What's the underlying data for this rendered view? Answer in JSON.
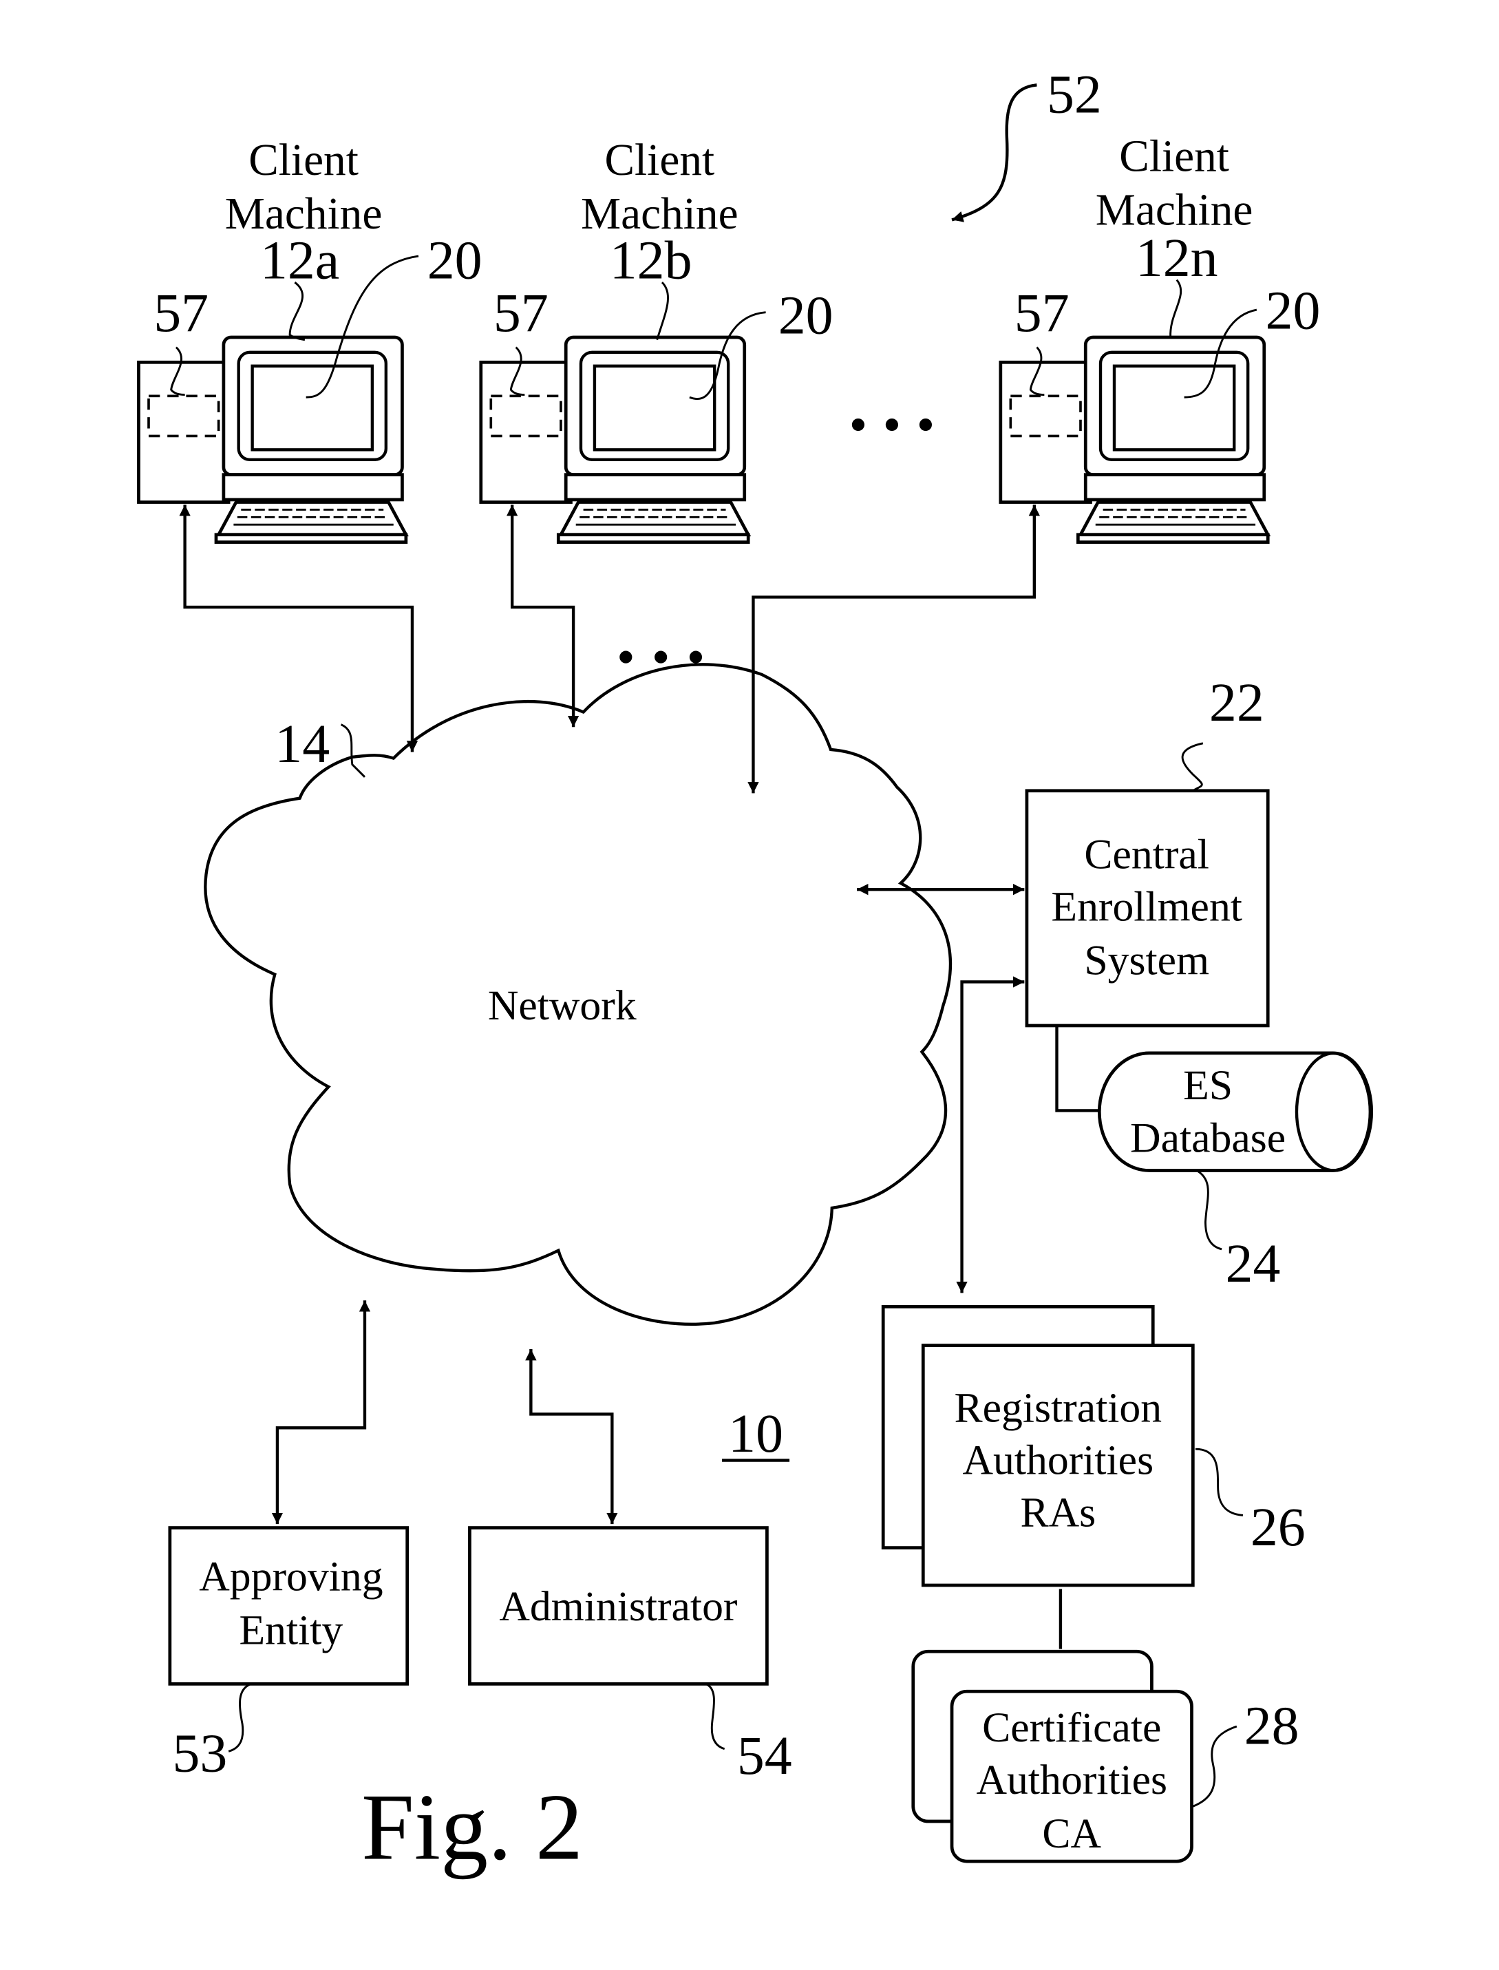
{
  "figure": {
    "title": "Fig. 2",
    "system_ref": "10",
    "group_ref": "52"
  },
  "clients": [
    {
      "line1": "Client",
      "line2": "Machine",
      "ref": "12a",
      "display_ref": "20",
      "storage_ref": "57"
    },
    {
      "line1": "Client",
      "line2": "Machine",
      "ref": "12b",
      "display_ref": "20",
      "storage_ref": "57"
    },
    {
      "line1": "Client",
      "line2": "Machine",
      "ref": "12n",
      "display_ref": "20",
      "storage_ref": "57"
    }
  ],
  "ellipsis": "• • •",
  "network": {
    "label": "Network",
    "ref": "14"
  },
  "central_enrollment": {
    "lines": [
      "Central",
      "Enrollment",
      "System"
    ],
    "ref": "22"
  },
  "es_database": {
    "lines": [
      "ES",
      "Database"
    ],
    "ref": "24"
  },
  "registration_authorities": {
    "lines": [
      "Registration",
      "Authorities",
      "RAs"
    ],
    "ref": "26"
  },
  "certificate_authorities": {
    "lines": [
      "Certificate",
      "Authorities",
      "CA"
    ],
    "ref": "28"
  },
  "approving_entity": {
    "lines": [
      "Approving",
      "Entity"
    ],
    "ref": "53"
  },
  "administrator": {
    "label": "Administrator",
    "ref": "54"
  }
}
